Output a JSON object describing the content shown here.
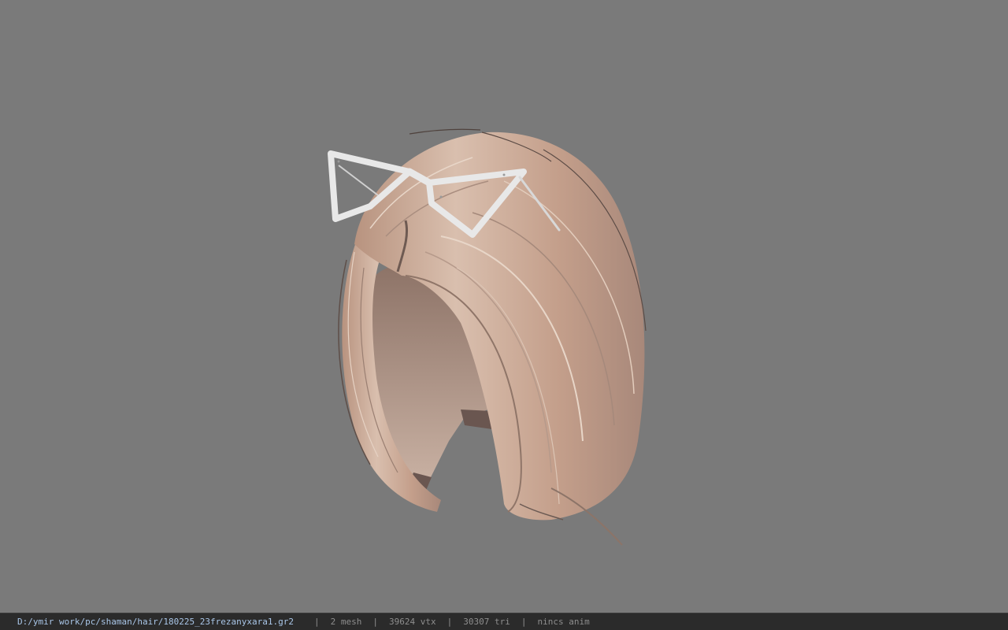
{
  "viewport": {
    "background_color": "#7a7a7a",
    "model": {
      "hair_color": "#c8a894",
      "accessory": "glasses-hairclip-icon",
      "accessory_color": "#e6e6e6"
    }
  },
  "status_bar": {
    "file_path": "D:/ymir work/pc/shaman/hair/180225_23frezanyxara1.gr2",
    "mesh_count": "2 mesh",
    "vertex_count": "39624 vtx",
    "triangle_count": "30307 tri",
    "anim_status": "nincs anim",
    "separator": "|"
  }
}
